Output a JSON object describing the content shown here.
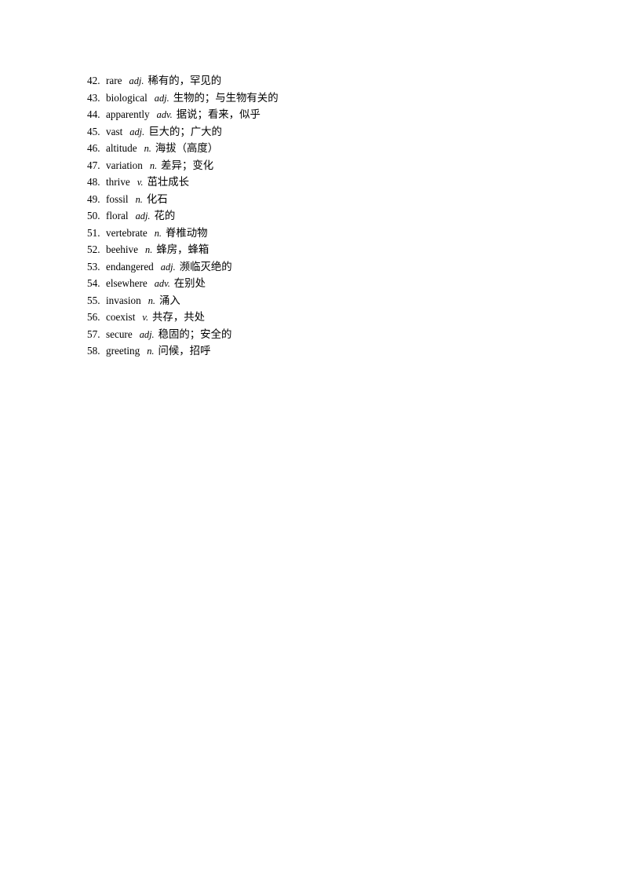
{
  "document": {
    "type": "vocabulary-list",
    "page_background": "#ffffff",
    "text_color": "#000000"
  },
  "vocabulary": {
    "entries": [
      {
        "num": "42.",
        "word": "rare",
        "pos": "adj.",
        "definition": "稀有的，罕见的"
      },
      {
        "num": "43.",
        "word": "biological",
        "pos": "adj.",
        "definition": "生物的；与生物有关的"
      },
      {
        "num": "44.",
        "word": "apparently",
        "pos": "adv.",
        "definition": "据说；看来，似乎"
      },
      {
        "num": "45.",
        "word": "vast",
        "pos": "adj.",
        "definition": "巨大的；广大的"
      },
      {
        "num": "46.",
        "word": "altitude",
        "pos": "n.",
        "definition": "海拔（高度）"
      },
      {
        "num": "47.",
        "word": "variation",
        "pos": "n.",
        "definition": "差异；变化"
      },
      {
        "num": "48.",
        "word": "thrive",
        "pos": "v.",
        "definition": "茁壮成长"
      },
      {
        "num": "49.",
        "word": "fossil",
        "pos": "n.",
        "definition": "化石"
      },
      {
        "num": "50.",
        "word": "floral",
        "pos": "adj.",
        "definition": "花的"
      },
      {
        "num": "51.",
        "word": "vertebrate",
        "pos": "n.",
        "definition": "脊椎动物"
      },
      {
        "num": "52.",
        "word": "beehive",
        "pos": "n.",
        "definition": "蜂房，蜂箱"
      },
      {
        "num": "53.",
        "word": "endangered",
        "pos": "adj.",
        "definition": "濒临灭绝的"
      },
      {
        "num": "54.",
        "word": "elsewhere",
        "pos": "adv.",
        "definition": "在别处"
      },
      {
        "num": "55.",
        "word": "invasion",
        "pos": "n.",
        "definition": "涌入"
      },
      {
        "num": "56.",
        "word": "coexist",
        "pos": "v.",
        "definition": "共存，共处"
      },
      {
        "num": "57.",
        "word": "secure",
        "pos": "adj.",
        "definition": "稳固的；安全的"
      },
      {
        "num": "58.",
        "word": "greeting",
        "pos": "n.",
        "definition": "问候，招呼"
      }
    ]
  }
}
